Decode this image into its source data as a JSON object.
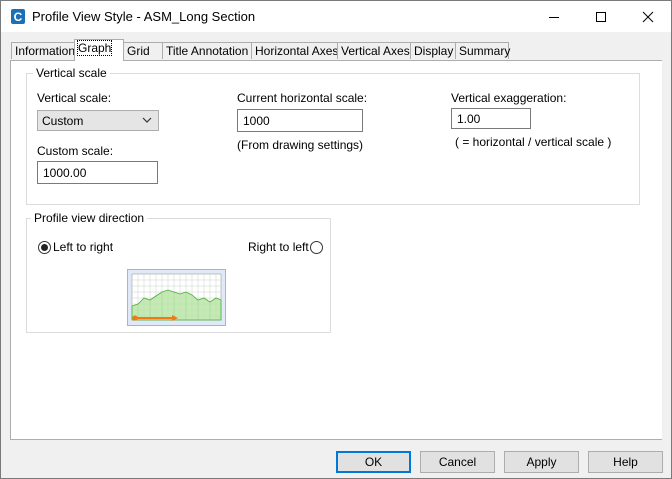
{
  "window": {
    "title": "Profile View Style - ASM_Long Section",
    "icon": "civil3d-app-icon"
  },
  "tabs": [
    {
      "label": "Information",
      "active": false
    },
    {
      "label": "Graph",
      "active": true
    },
    {
      "label": "Grid",
      "active": false
    },
    {
      "label": "Title Annotation",
      "active": false
    },
    {
      "label": "Horizontal Axes",
      "active": false
    },
    {
      "label": "Vertical Axes",
      "active": false
    },
    {
      "label": "Display",
      "active": false
    },
    {
      "label": "Summary",
      "active": false
    }
  ],
  "vertical_scale_group": {
    "title": "Vertical scale",
    "vertical_scale_label": "Vertical scale:",
    "vertical_scale_value": "Custom",
    "custom_scale_label": "Custom scale:",
    "custom_scale_value": "1000.00",
    "current_horizontal_label": "Current horizontal scale:",
    "current_horizontal_value": "1000",
    "current_horizontal_note": "(From drawing settings)",
    "exaggeration_label": "Vertical exaggeration:",
    "exaggeration_value": "1.00",
    "exaggeration_note": "( = horizontal / vertical scale )"
  },
  "direction_group": {
    "title": "Profile view direction",
    "left_to_right_label": "Left to right",
    "left_to_right_checked": true,
    "right_to_left_label": "Right to left",
    "right_to_left_checked": false
  },
  "buttons": {
    "ok": "OK",
    "cancel": "Cancel",
    "apply": "Apply",
    "help": "Help"
  }
}
